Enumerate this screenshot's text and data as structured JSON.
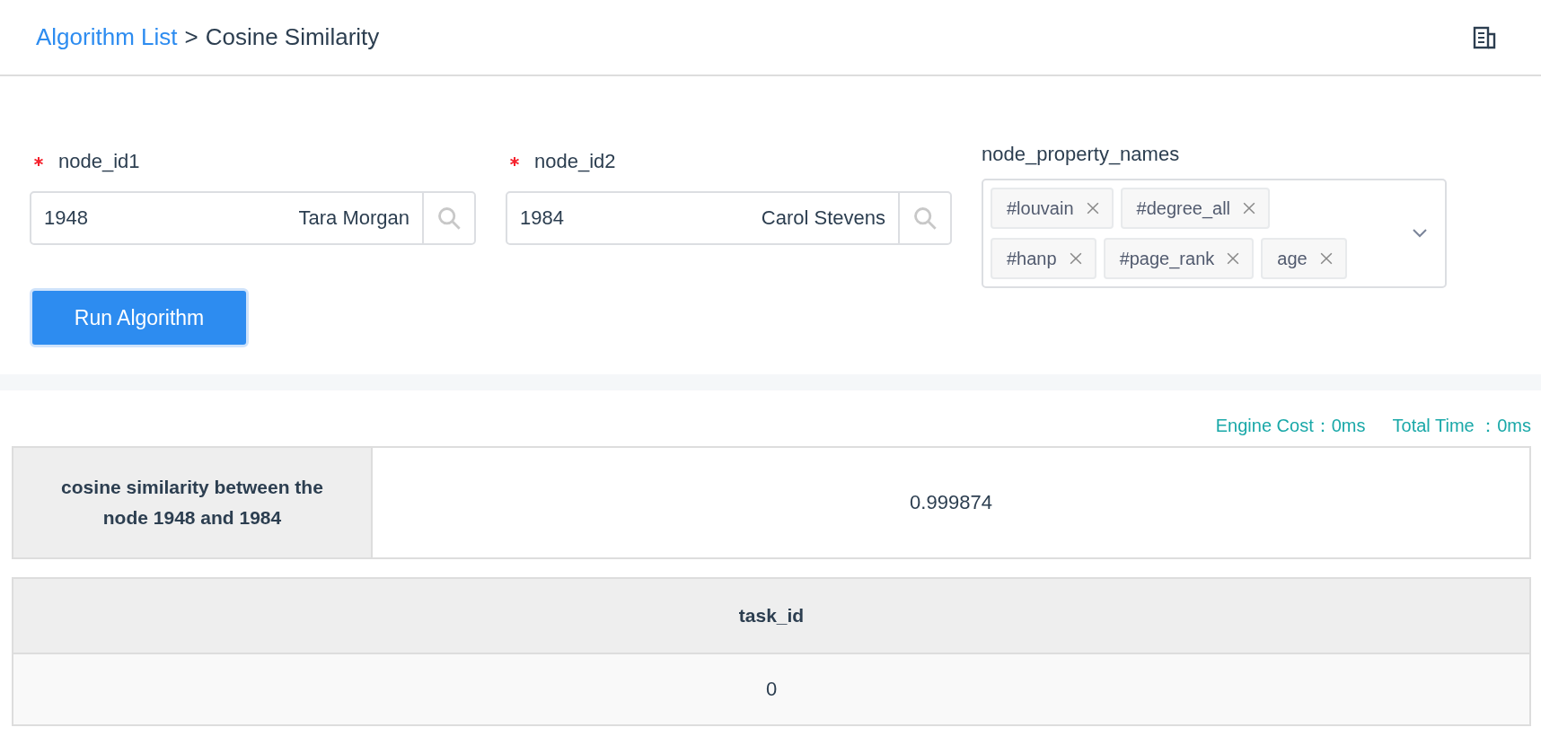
{
  "breadcrumb": {
    "link": "Algorithm List",
    "separator": ">",
    "current": "Cosine Similarity"
  },
  "fields": [
    {
      "label": "node_id1",
      "required": true,
      "value": "1948",
      "name": "Tara Morgan"
    },
    {
      "label": "node_id2",
      "required": true,
      "value": "1984",
      "name": "Carol Stevens"
    }
  ],
  "property_select": {
    "label": "node_property_names",
    "tags": [
      "#louvain",
      "#degree_all",
      "#hanp",
      "#page_rank",
      "age"
    ]
  },
  "run_button": "Run Algorithm",
  "timing": {
    "engine_cost": "Engine Cost：0ms",
    "total_time": "Total Time ：0ms"
  },
  "result_table": {
    "header": "cosine similarity between the node 1948 and 1984",
    "value": "0.999874"
  },
  "task_table": {
    "columns": [
      "task_id"
    ],
    "rows": [
      [
        "0"
      ]
    ]
  }
}
